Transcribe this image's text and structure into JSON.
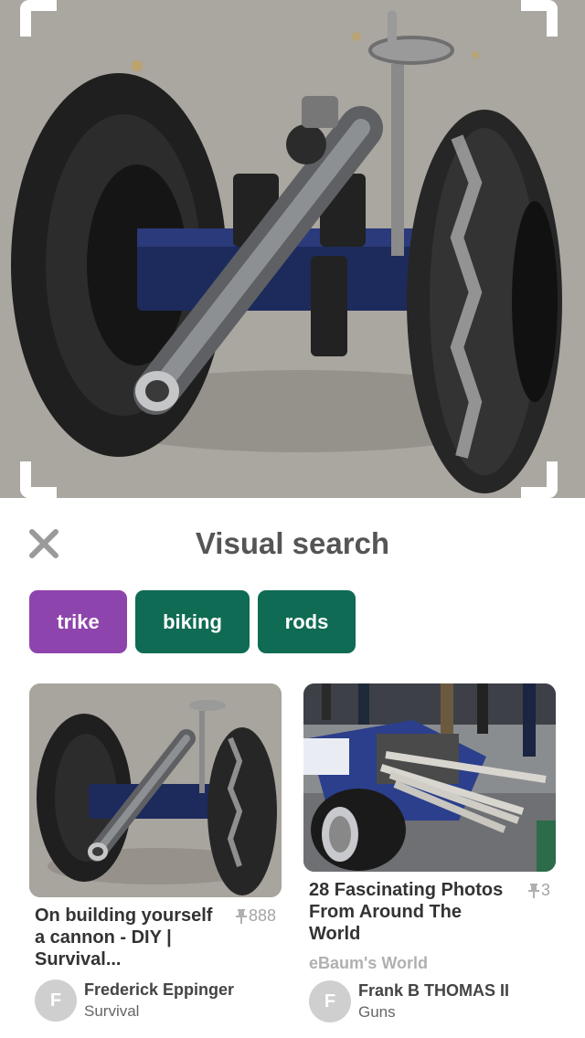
{
  "title": "Visual search",
  "hero": {
    "subject": "cannon on tire wheels"
  },
  "chips": [
    {
      "label": "trike",
      "color": "#8e44ad"
    },
    {
      "label": "biking",
      "color": "#0f6b53"
    },
    {
      "label": "rods",
      "color": "#0f6b53"
    }
  ],
  "results": [
    {
      "title": "On building yourself a cannon - DIY | Survival...",
      "pin_count": "888",
      "source": "",
      "user": {
        "initial": "F",
        "name": "Frederick Eppinger",
        "board": "Survival"
      }
    },
    {
      "title": "28 Fascinating Photos From Around The World",
      "pin_count": "3",
      "source": "eBaum's World",
      "user": {
        "initial": "F",
        "name": "Frank B THOMAS II",
        "board": "Guns"
      }
    }
  ],
  "colors": {
    "accent_purple": "#8e44ad",
    "accent_green": "#0f6b53",
    "title_gray": "#555555"
  },
  "icons": {
    "close": "close-icon",
    "pin": "pin-icon"
  }
}
